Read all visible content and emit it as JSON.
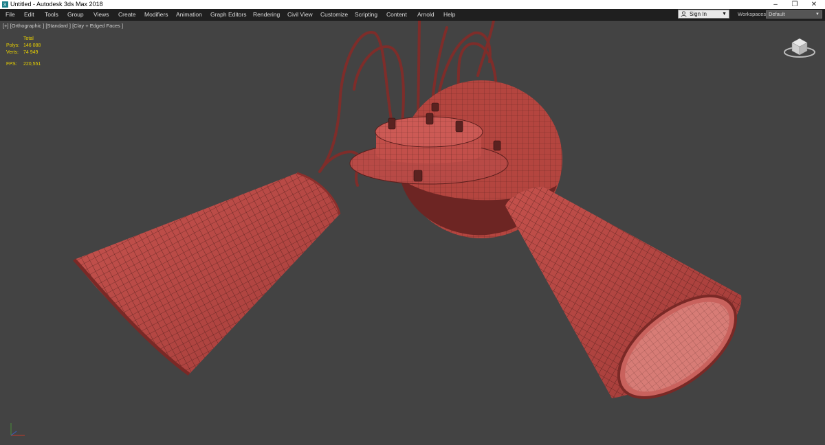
{
  "window": {
    "title": "Untitled - Autodesk 3ds Max 2018",
    "minimize_glyph": "–",
    "restore_glyph": "❐",
    "close_glyph": "✕"
  },
  "menu": [
    "File",
    "Edit",
    "Tools",
    "Group",
    "Views",
    "Create",
    "Modifiers",
    "Animation",
    "Graph Editors",
    "Rendering",
    "Civil View",
    "Customize",
    "Scripting",
    "Content",
    "Arnold",
    "Help"
  ],
  "account": {
    "sign_in": "Sign In"
  },
  "workspaces": {
    "label": "Workspaces:",
    "value": "Default"
  },
  "viewport": {
    "label": "[+] [Orthographic ] [Standard ] [Clay + Edged Faces ]",
    "stats": {
      "header": "Total",
      "polys_label": "Polys:",
      "polys_value": "146 088",
      "verts_label": "Verts:",
      "verts_value": "74 949",
      "fps_label": "FPS:",
      "fps_value": "220,551"
    }
  },
  "colors": {
    "model_fill": "#b84a46",
    "model_dark": "#6d2523",
    "wire": "#3a1614",
    "viewport_bg": "#434343",
    "stats_text": "#e8d000"
  },
  "icons": [
    "app-icon",
    "user-icon",
    "viewcube-icon",
    "axis-tripod-icon"
  ]
}
